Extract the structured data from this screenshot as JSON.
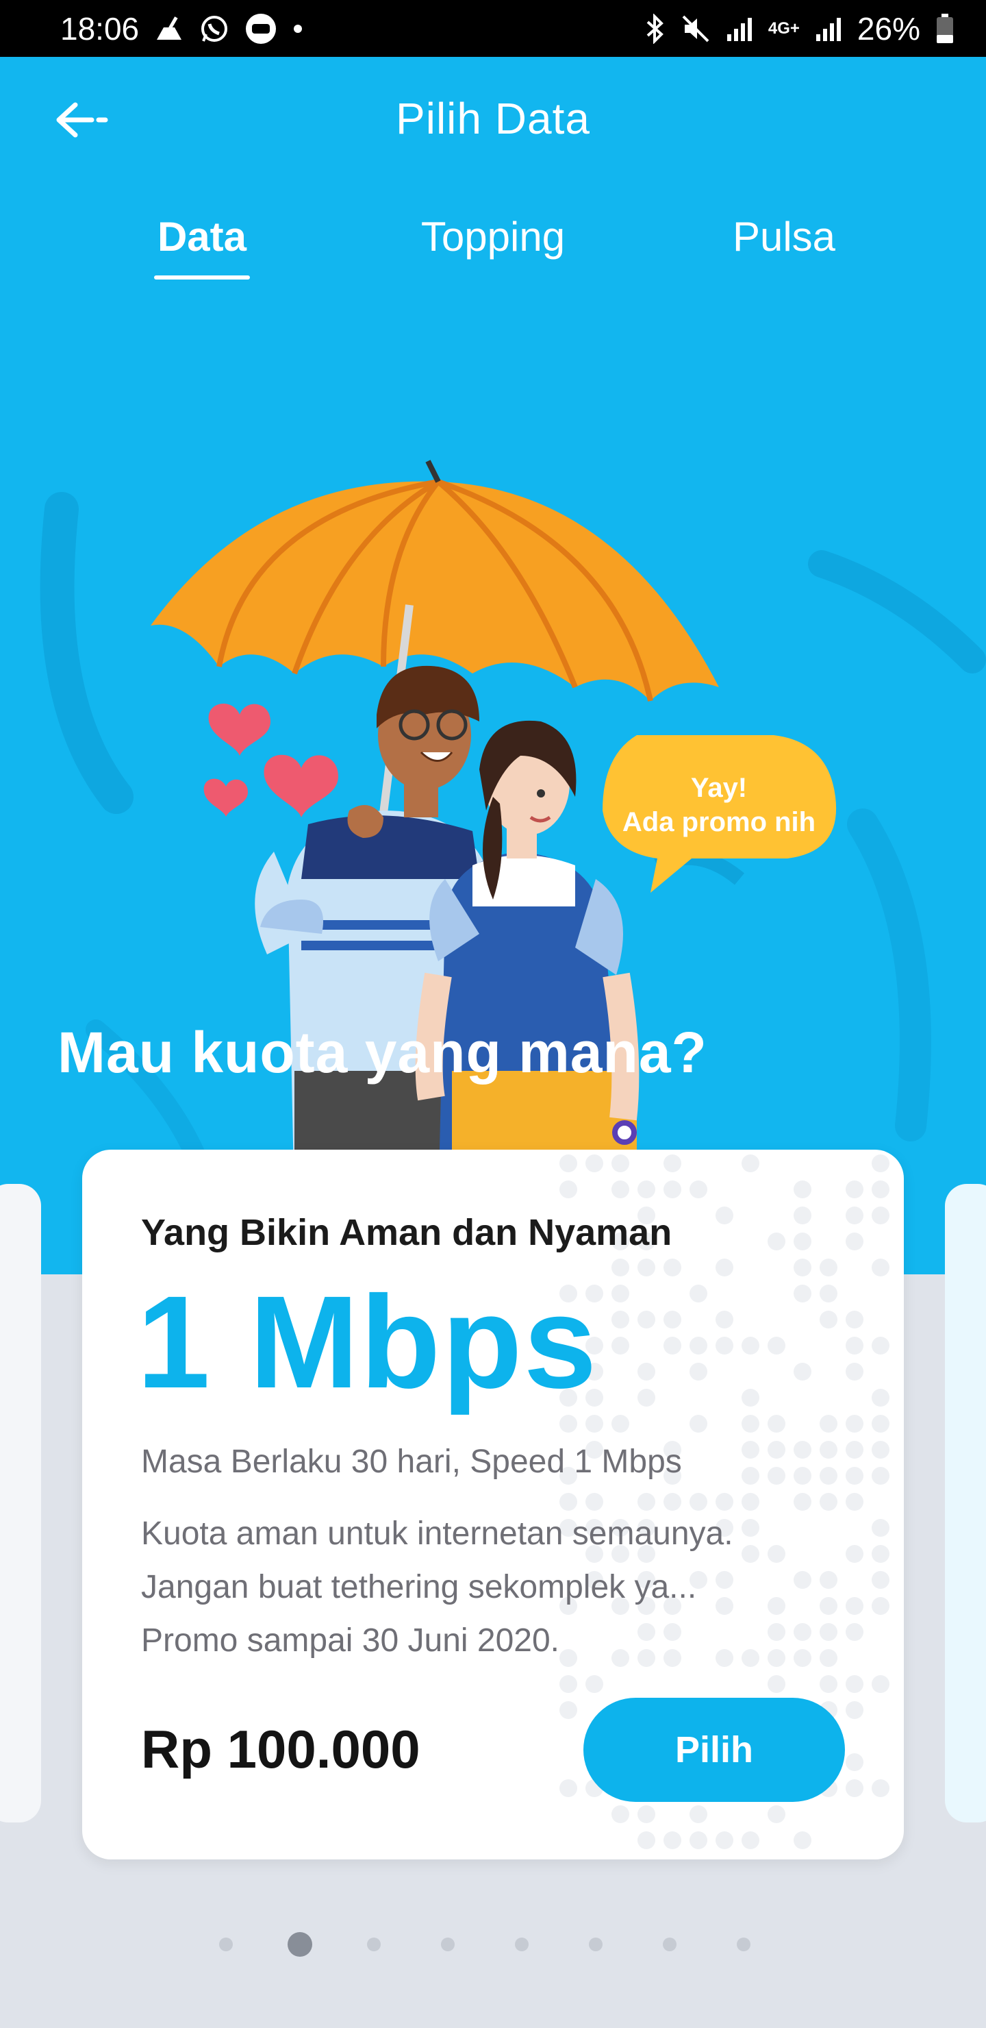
{
  "status_bar": {
    "time": "18:06",
    "network": "4G+",
    "battery": "26%"
  },
  "header": {
    "title": "Pilih Data",
    "back_icon": "back-arrow-icon"
  },
  "tabs": [
    {
      "label": "Data",
      "active": true
    },
    {
      "label": "Topping",
      "active": false
    },
    {
      "label": "Pulsa",
      "active": false
    }
  ],
  "hero": {
    "bubble_line1": "Yay!",
    "bubble_line2": "Ada promo nih",
    "headline": "Mau kuota yang mana?"
  },
  "package_card": {
    "title": "Yang Bikin Aman dan Nyaman",
    "speed": "1 Mbps",
    "validity": "Masa Berlaku 30 hari, Speed 1 Mbps",
    "description_line1": "Kuota aman untuk internetan semaunya.",
    "description_line2": "Jangan buat tethering sekomplek ya...",
    "description_line3": "Promo sampai 30 Juni 2020.",
    "price": "Rp 100.000",
    "select_label": "Pilih"
  },
  "pager": {
    "count": 8,
    "active_index": 1
  },
  "colors": {
    "primary": "#12b6ef",
    "accent_text": "#0db3ec",
    "background": "#dfe3ea",
    "umbrella": "#f28a24",
    "bubble": "#ffc233"
  }
}
